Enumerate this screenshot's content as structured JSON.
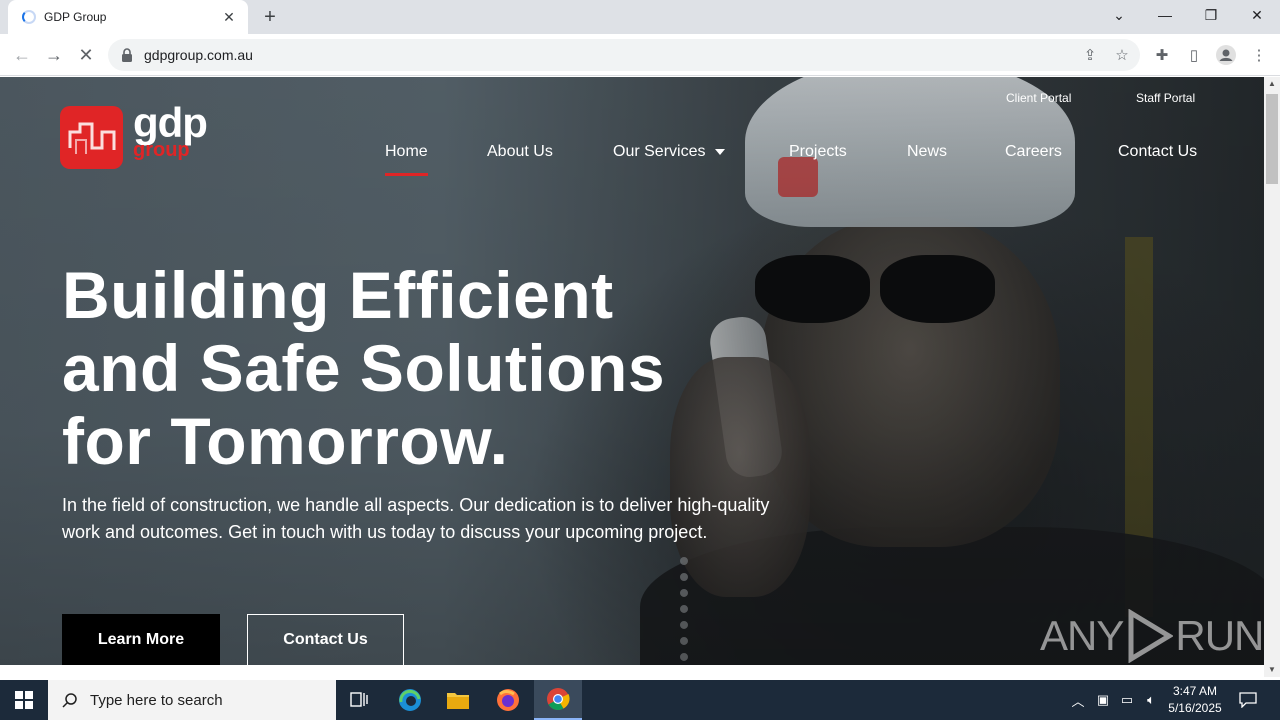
{
  "browser": {
    "tab_title": "GDP Group",
    "url": "gdpgroup.com.au"
  },
  "site": {
    "logo_text": "gdp",
    "logo_subtext": "group",
    "portals": [
      "Client Portal",
      "Staff Portal"
    ],
    "nav": [
      {
        "label": "Home",
        "active": true
      },
      {
        "label": "About Us"
      },
      {
        "label": "Our Services",
        "dropdown": true
      },
      {
        "label": "Projects"
      },
      {
        "label": "News"
      },
      {
        "label": "Careers"
      },
      {
        "label": "Contact Us"
      }
    ],
    "headline": [
      "Building Efficient",
      "and Safe Solutions",
      "for Tomorrow."
    ],
    "subtext": "In the field of construction, we handle all aspects. Our dedication is to deliver high-quality work and outcomes. Get in touch with us today to discuss your upcoming project.",
    "buttons": {
      "learn_more": "Learn More",
      "contact_us": "Contact Us"
    },
    "watermark": {
      "left": "ANY",
      "right": "RUN"
    }
  },
  "taskbar": {
    "search_placeholder": "Type here to search",
    "time": "3:47 AM",
    "date": "5/16/2025"
  },
  "colors": {
    "brand_red": "#e02526",
    "taskbar": "#1c2a3a"
  }
}
